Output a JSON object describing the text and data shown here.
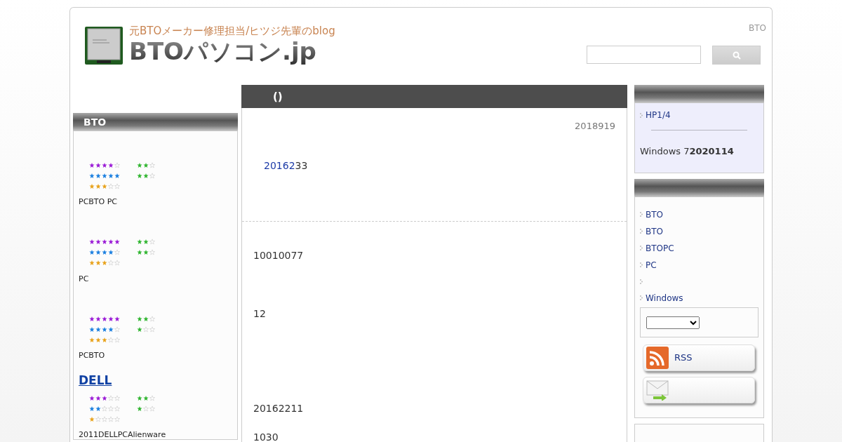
{
  "header": {
    "tagline": "元BTOメーカー修理担当/ヒツジ先輩のblog",
    "site_name": "BTOパソコン.jp",
    "corner_text": "BTO"
  },
  "left_panel": {
    "title": "BTO",
    "products": [
      {
        "ratings": [
          {
            "color": "#9a1ad6",
            "stars": 4
          },
          {
            "color": "#1a7fe0",
            "stars": 5
          },
          {
            "color": "#e8a21a",
            "stars": 3
          }
        ],
        "sub_ratings": [
          {
            "color": "#2fb52f",
            "stars": 2
          },
          {
            "color": "#2fb52f",
            "stars": 2
          }
        ],
        "caption": "PCBTO PC"
      },
      {
        "ratings": [
          {
            "color": "#9a1ad6",
            "stars": 5
          },
          {
            "color": "#1a7fe0",
            "stars": 4
          },
          {
            "color": "#e8a21a",
            "stars": 3
          }
        ],
        "sub_ratings": [
          {
            "color": "#2fb52f",
            "stars": 2
          },
          {
            "color": "#2fb52f",
            "stars": 2
          }
        ],
        "caption": "PC"
      },
      {
        "ratings": [
          {
            "color": "#9a1ad6",
            "stars": 5
          },
          {
            "color": "#1a7fe0",
            "stars": 4
          },
          {
            "color": "#e8a21a",
            "stars": 3
          }
        ],
        "sub_ratings": [
          {
            "color": "#2fb52f",
            "stars": 2
          },
          {
            "color": "#2fb52f",
            "stars": 1
          }
        ],
        "caption": "PCBTO"
      },
      {
        "heading": "DELL",
        "ratings": [
          {
            "color": "#9a1ad6",
            "stars": 3
          },
          {
            "color": "#1a7fe0",
            "stars": 2
          },
          {
            "color": "#e8a21a",
            "stars": 1
          }
        ],
        "sub_ratings": [
          {
            "color": "#2fb52f",
            "stars": 2
          },
          {
            "color": "#2fb52f",
            "stars": 1
          }
        ],
        "caption": "2011DELLPCAlienware"
      }
    ]
  },
  "article": {
    "title": "()",
    "date": "2018919",
    "intro_link": "20162",
    "intro_rest": "33",
    "paragraphs": [
      "10010077",
      "12",
      "20162211",
      "1030"
    ]
  },
  "right_panel": {
    "notice": {
      "link": "HP1/4",
      "text": "Windows 7**2020114**"
    },
    "links": [
      {
        "kind": "link",
        "text": "BTO"
      },
      {
        "kind": "link",
        "text": "BTO"
      },
      {
        "kind": "link",
        "text": "BTOPC"
      },
      {
        "kind": "link",
        "text": "PC"
      },
      {
        "kind": "blank"
      },
      {
        "kind": "link",
        "text": "Windows"
      }
    ],
    "feed_button": "RSS"
  }
}
